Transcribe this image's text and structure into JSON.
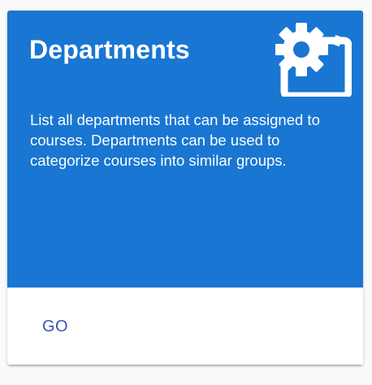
{
  "card": {
    "title": "Departments",
    "description": "List all departments that can be assigned to courses. Departments can be used to categorize courses into similar groups.",
    "icon": "settings-applications-icon",
    "action_label": "GO"
  },
  "colors": {
    "header_background": "#1976d2",
    "header_text": "#ffffff",
    "action_text": "#3f51b5",
    "page_background": "#fafafa"
  }
}
